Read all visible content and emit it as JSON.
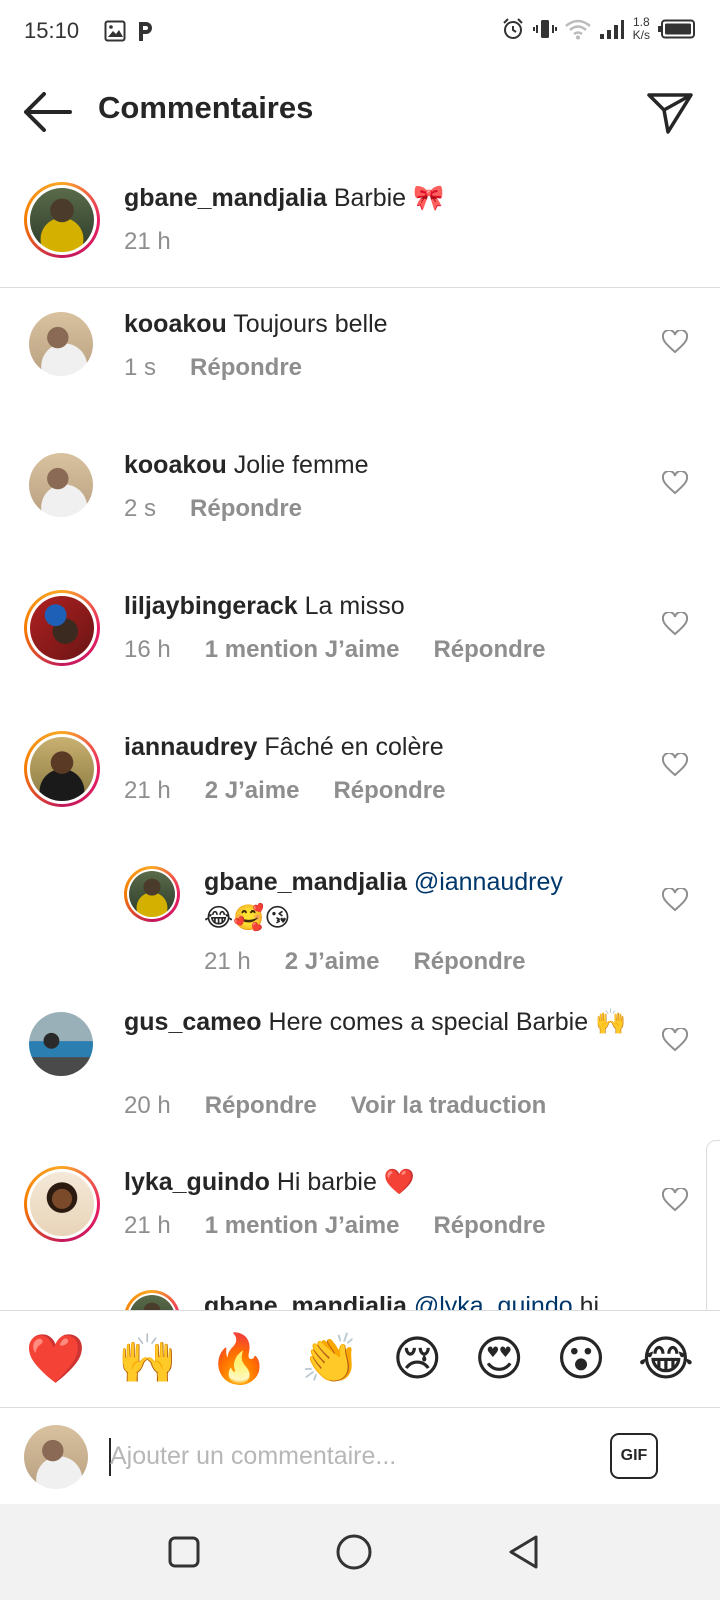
{
  "status_bar": {
    "time": "15:10",
    "net_speed_value": "1.8",
    "net_speed_unit": "K/s",
    "icons": [
      "image-icon",
      "p-app-icon",
      "alarm-icon",
      "vibrate-icon",
      "wifi-icon",
      "signal-icon",
      "battery-icon"
    ]
  },
  "header": {
    "title": "Commentaires",
    "back_icon": "arrow-left-icon",
    "share_icon": "send-icon"
  },
  "caption": {
    "username": "gbane_mandjalia",
    "text": "Barbie 🎀",
    "time": "21 h"
  },
  "comments": [
    {
      "username": "kooakou",
      "text": "Toujours belle",
      "time": "1 s",
      "likes": "",
      "reply": "Répondre"
    },
    {
      "username": "kooakou",
      "text": "Jolie femme",
      "time": "2 s",
      "likes": "",
      "reply": "Répondre"
    },
    {
      "username": "liljaybingerack",
      "text": "La misso",
      "time": "16 h",
      "likes": "1 mention J’aime",
      "reply": "Répondre"
    },
    {
      "username": "iannaudrey",
      "text": "Fâché en colère",
      "time": "21 h",
      "likes": "2 J’aime",
      "reply": "Répondre"
    },
    {
      "username": "gbane_mandjalia",
      "mention": "@iannaudrey",
      "text": "😂🥰😘",
      "time": "21 h",
      "likes": "2 J’aime",
      "reply": "Répondre"
    },
    {
      "username": "gus_cameo",
      "text": "Here comes a special Barbie 🙌",
      "time": "20 h",
      "reply": "Répondre",
      "translate": "Voir la traduction"
    },
    {
      "username": "lyka_guindo",
      "text": "Hi barbie ❤️",
      "time": "21 h",
      "likes": "1 mention J’aime",
      "reply": "Répondre"
    },
    {
      "username": "gbane_mandjalia",
      "mention": "@lyka_guindo",
      "text": "hi"
    }
  ],
  "emoji_bar": [
    "❤️",
    "🙌",
    "🔥",
    "👏",
    "😢",
    "😍",
    "😮",
    "😂"
  ],
  "input": {
    "placeholder": "Ajouter un commentaire...",
    "gif_label": "GIF"
  },
  "colors": {
    "text": "#262626",
    "secondary": "#8e8e8e",
    "mention": "#00376b",
    "divider": "#dbdbdb",
    "nav_bg": "#f2f2f2"
  }
}
